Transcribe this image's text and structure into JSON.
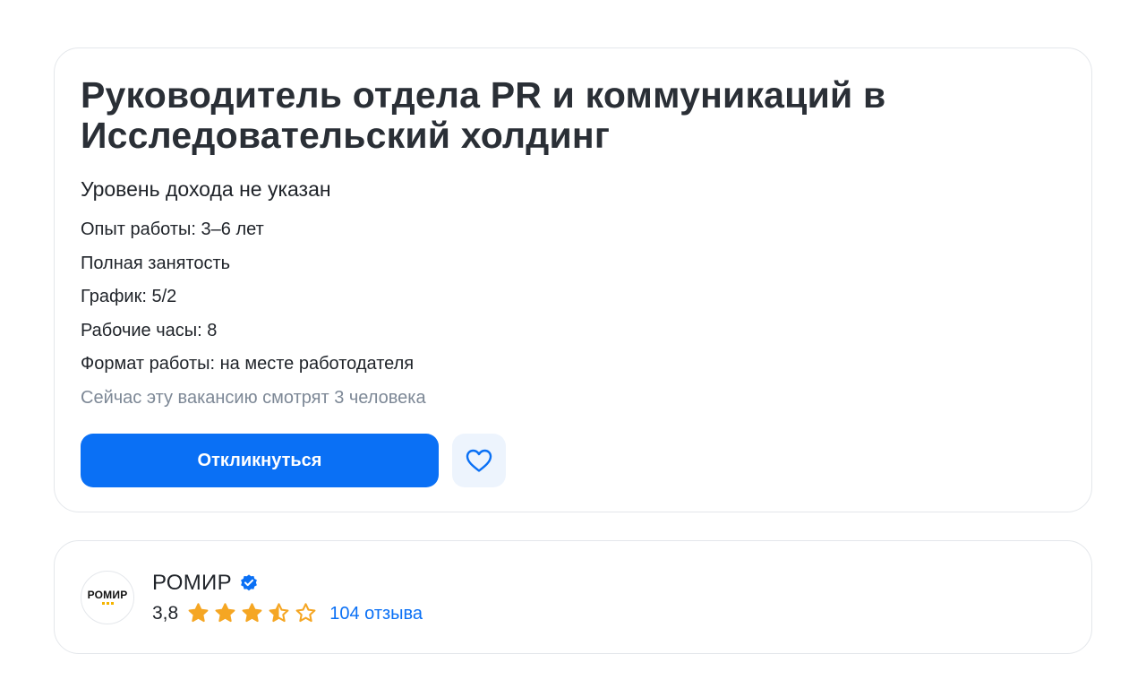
{
  "vacancy": {
    "title": "Руководитель отдела PR и коммуникаций в Исследовательский холдинг",
    "salary": "Уровень дохода не указан",
    "facts": [
      "Опыт работы: 3–6 лет",
      "Полная занятость",
      "График: 5/2",
      "Рабочие часы: 8",
      "Формат работы: на месте работодателя"
    ],
    "watching": "Сейчас эту вакансию смотрят 3 человека",
    "apply_label": "Откликнуться",
    "favorite_icon": "heart-icon"
  },
  "company": {
    "logo_text": "РОМИР",
    "name": "РОМИР",
    "verified_icon": "verified-badge-icon",
    "rating": "3,8",
    "rating_value": 3.8,
    "stars_max": 5,
    "reviews_label": "104 отзыва"
  },
  "colors": {
    "accent": "#0a70f5",
    "star": "#f5a623",
    "muted_text": "#7d8896",
    "favorite_bg": "#edf4fd"
  }
}
